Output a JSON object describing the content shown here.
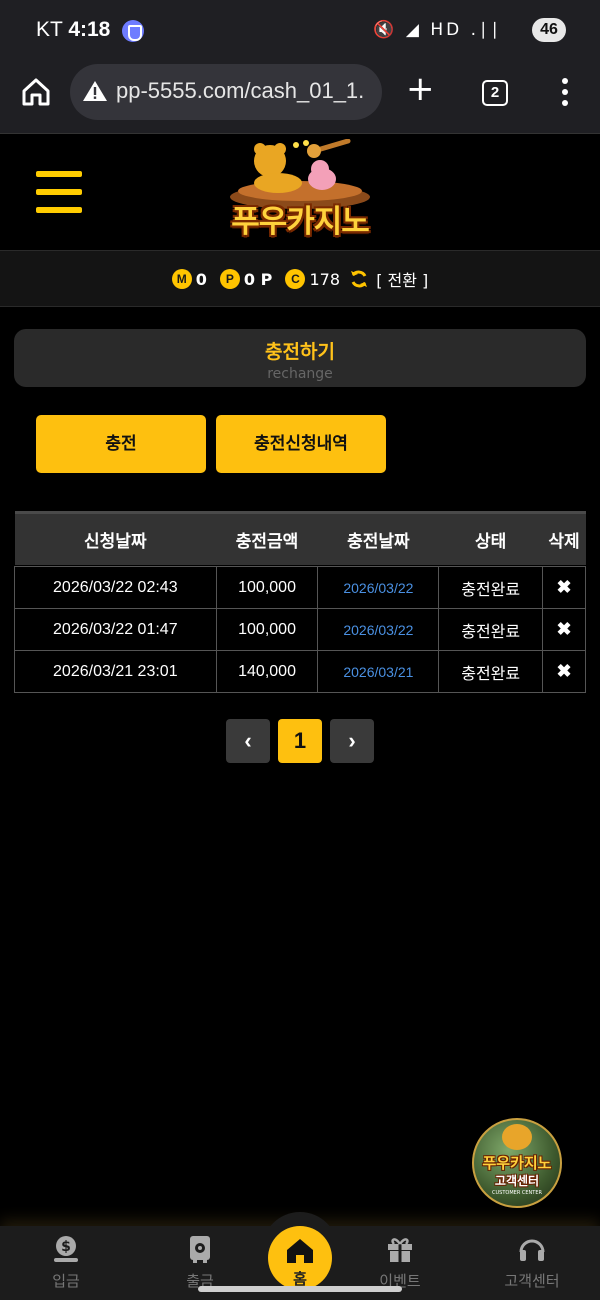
{
  "status_bar": {
    "carrier": "KT",
    "time": "4:18",
    "icons": "🔇 ◢ HD .∣∣",
    "battery": "46"
  },
  "browser": {
    "url": "pp-5555.com/cash_01_1.",
    "tab_count": "2"
  },
  "site": {
    "logo_text": "푸우카지노"
  },
  "balance": {
    "m_badge": "M",
    "m_value": "0",
    "p_badge": "P",
    "p_value": "0 P",
    "c_badge": "C",
    "c_value": "178",
    "convert_label": "[ 전환 ]"
  },
  "section": {
    "title": "충전하기",
    "subtitle": "rechange"
  },
  "tabs": [
    {
      "label": "충전"
    },
    {
      "label": "충전신청내역"
    }
  ],
  "table": {
    "headers": [
      "신청날짜",
      "충전금액",
      "충전날짜",
      "상태",
      "삭제"
    ],
    "rows": [
      {
        "requested": "2026/03/22 02:43",
        "amount": "100,000",
        "charged": "2026/03/22",
        "status": "충전완료",
        "delete": "✖"
      },
      {
        "requested": "2026/03/22 01:47",
        "amount": "100,000",
        "charged": "2026/03/22",
        "status": "충전완료",
        "delete": "✖"
      },
      {
        "requested": "2026/03/21 23:01",
        "amount": "140,000",
        "charged": "2026/03/21",
        "status": "충전완료",
        "delete": "✖"
      }
    ]
  },
  "pagination": {
    "prev": "‹",
    "current": "1",
    "next": "›"
  },
  "cs_float": {
    "line1": "푸우카지노",
    "line2": "고객센터",
    "line3": "CUSTOMER CENTER"
  },
  "bottom_nav": {
    "deposit": "입금",
    "withdraw": "출금",
    "home": "홈",
    "event": "이벤트",
    "support": "고객센터"
  },
  "colors": {
    "accent": "#fec00f",
    "link": "#4a90e2",
    "background": "#000000"
  }
}
